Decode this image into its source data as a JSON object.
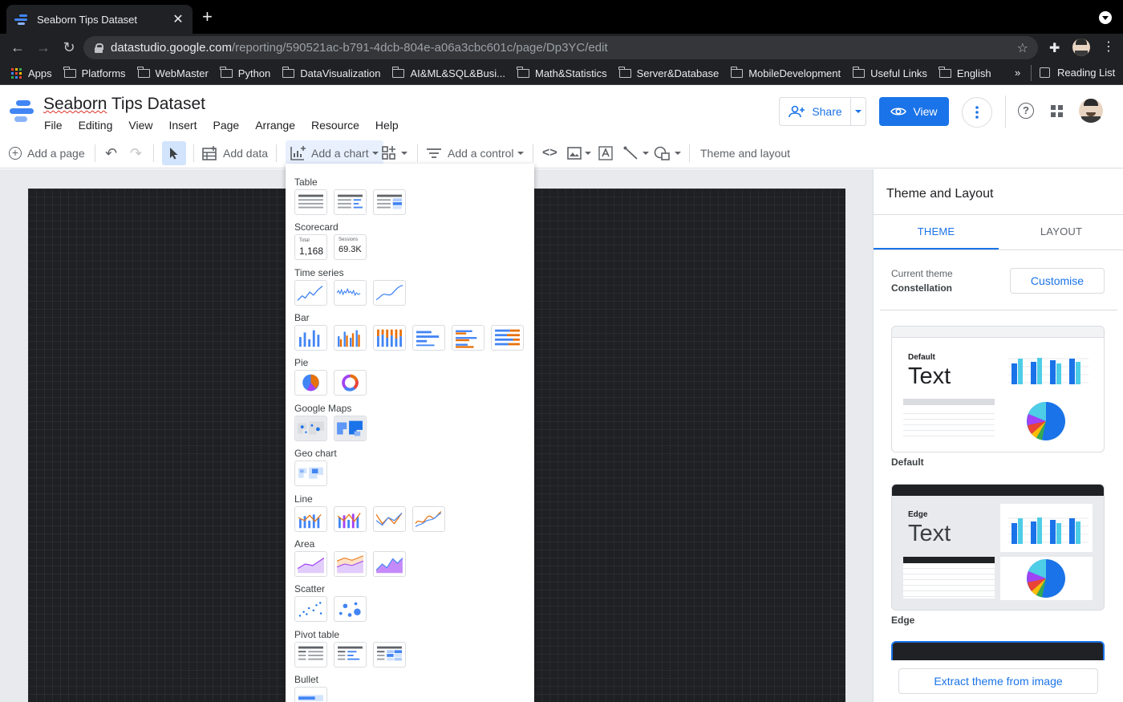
{
  "browser": {
    "tab_title": "Seaborn Tips Dataset",
    "url_host": "datastudio.google.com",
    "url_path": "/reporting/590521ac-b791-4dcb-804e-a06a3cbc601c/page/Dp3YC/edit",
    "bookmarks": [
      "Apps",
      "Platforms",
      "WebMaster",
      "Python",
      "DataVisualization",
      "AI&ML&SQL&Busi...",
      "Math&Statistics",
      "Server&Database",
      "MobileDevelopment",
      "Useful Links",
      "English"
    ],
    "overflow": "»",
    "reading_list": "Reading List"
  },
  "app": {
    "title_first": "Seaborn",
    "title_rest": " Tips Dataset",
    "menus": [
      "File",
      "Editing",
      "View",
      "Insert",
      "Page",
      "Arrange",
      "Resource",
      "Help"
    ],
    "share_label": "Share",
    "view_label": "View"
  },
  "toolbar": {
    "add_page": "Add a page",
    "add_data": "Add data",
    "add_chart": "Add a chart",
    "add_control": "Add a control",
    "theme_layout": "Theme and layout"
  },
  "chart_menu": {
    "categories": [
      "Table",
      "Scorecard",
      "Time series",
      "Bar",
      "Pie",
      "Google Maps",
      "Geo chart",
      "Line",
      "Area",
      "Scatter",
      "Pivot table",
      "Bullet"
    ],
    "scorecard_1_label": "Total",
    "scorecard_1_value": "1,168",
    "scorecard_2_label": "Sessions",
    "scorecard_2_value": "69.3K"
  },
  "panel": {
    "title": "Theme and Layout",
    "tab_theme": "THEME",
    "tab_layout": "LAYOUT",
    "current_theme_label": "Current theme",
    "current_theme_value": "Constellation",
    "customise": "Customise",
    "themes": [
      {
        "name": "Default",
        "preview_tag": "Default",
        "preview_text": "Text"
      },
      {
        "name": "Edge",
        "preview_tag": "Edge",
        "preview_text": "Text"
      }
    ],
    "extract": "Extract theme from image"
  },
  "colors": {
    "accent": "#1a73e8",
    "chrome_dark": "#202124",
    "canvas": "#1f2023"
  }
}
